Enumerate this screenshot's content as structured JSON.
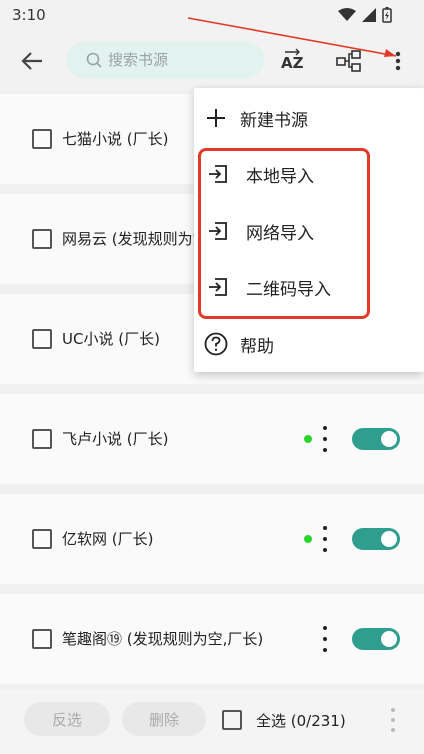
{
  "status_bar": {
    "time": "3:10"
  },
  "toolbar": {
    "search_placeholder": "搜索书源",
    "sort_label": "AZ"
  },
  "sources": [
    {
      "name": "七猫小说 (厂长)"
    },
    {
      "name": "网易云 (发现规则为空,厂长)"
    },
    {
      "name": "UC小说 (厂长)"
    },
    {
      "name": "飞卢小说 (厂长)",
      "status_dot": true,
      "enabled": true
    },
    {
      "name": "亿软网 (厂长)",
      "status_dot": true,
      "enabled": true
    },
    {
      "name": "笔趣阁⑲ (发现规则为空,厂长)",
      "status_dot": false,
      "enabled": true
    }
  ],
  "menu": {
    "new_source": "新建书源",
    "local_import": "本地导入",
    "network_import": "网络导入",
    "qr_import": "二维码导入",
    "help": "帮助"
  },
  "bottom_bar": {
    "invert_label": "反选",
    "delete_label": "删除",
    "select_all_label": "全选 (0/231)"
  },
  "colors": {
    "accent": "#2f9e8e",
    "search_bg": "#e2f2ee",
    "status_dot": "#2bd42b",
    "annotation_red": "#e23a2a"
  }
}
